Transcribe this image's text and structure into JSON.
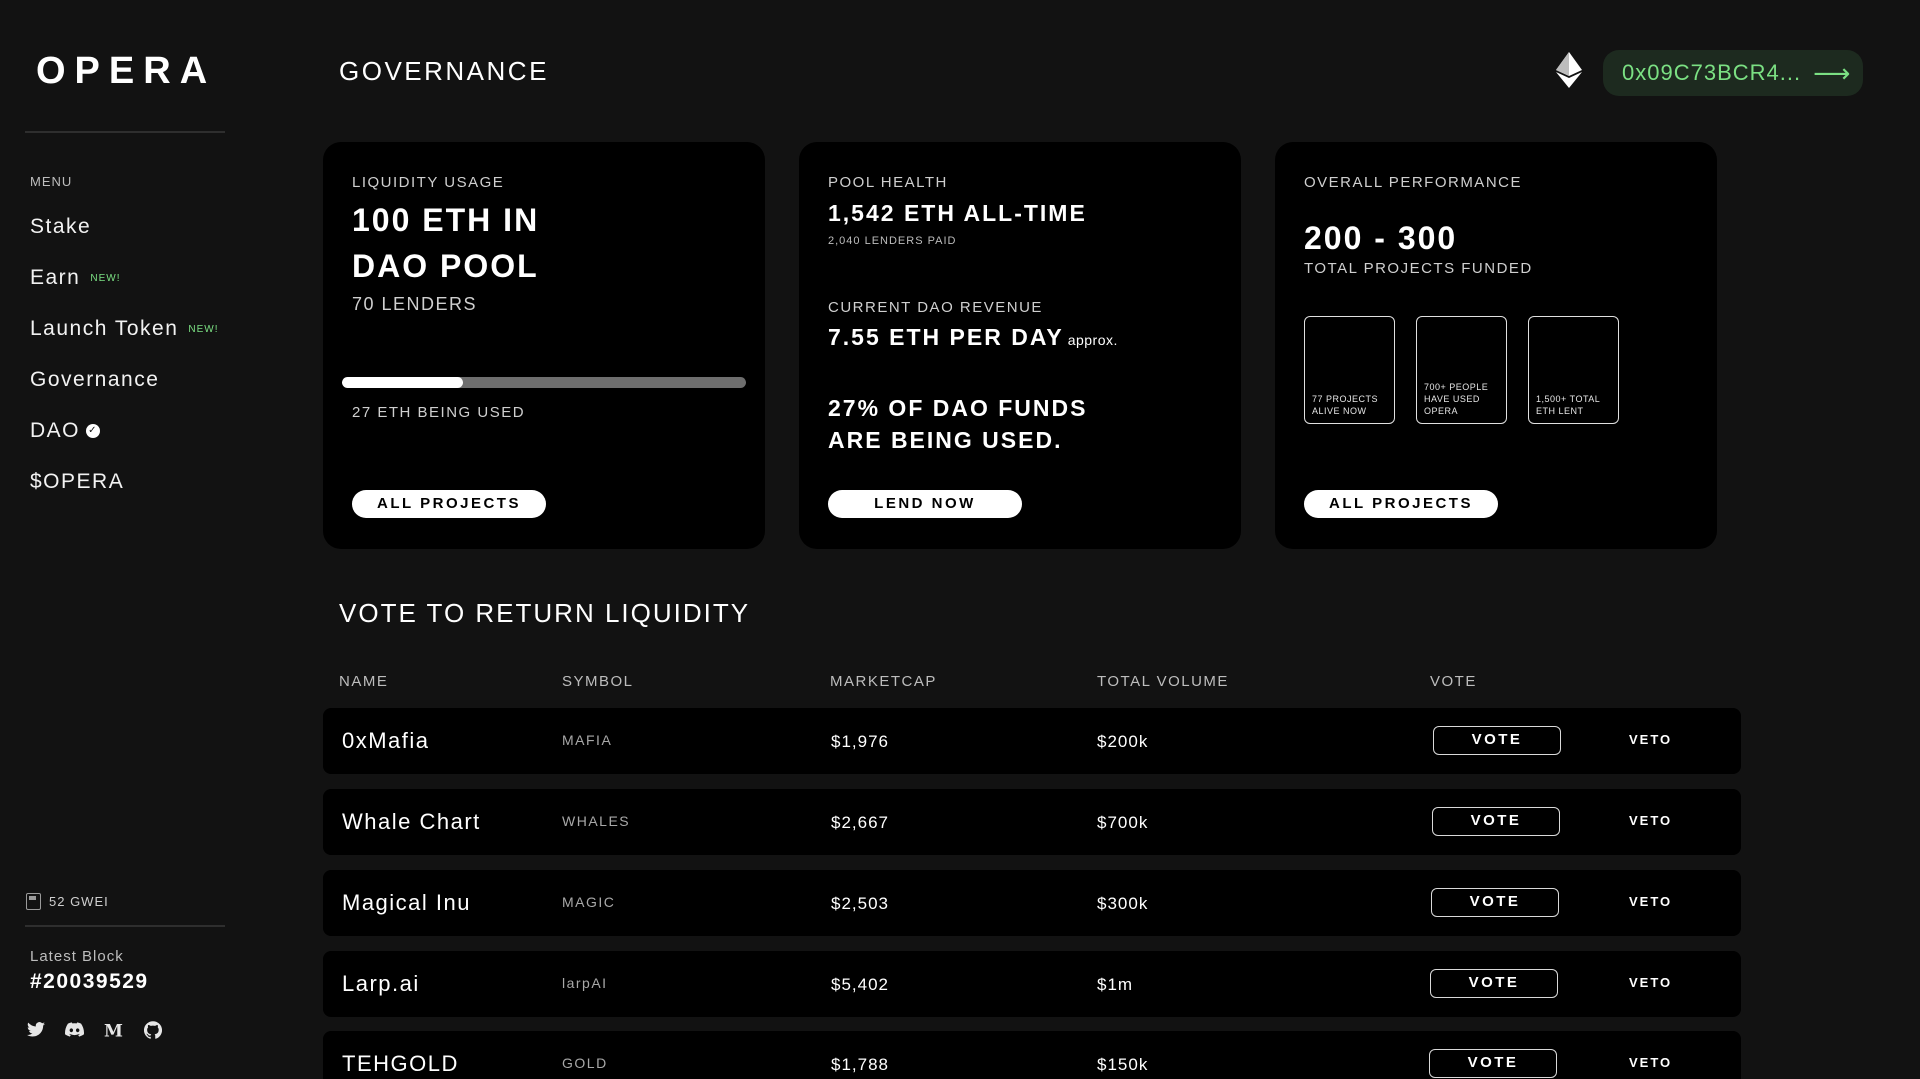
{
  "app": {
    "logo": "OPERA"
  },
  "sidebar": {
    "menu_title": "MENU",
    "items": [
      {
        "label": "Stake",
        "badge": ""
      },
      {
        "label": "Earn",
        "badge": "NEW!"
      },
      {
        "label": "Launch Token",
        "badge": "NEW!"
      },
      {
        "label": "Governance",
        "badge": ""
      },
      {
        "label": "DAO",
        "badge": ""
      },
      {
        "label": "$OPERA",
        "badge": ""
      }
    ],
    "gas": "52 GWEI",
    "latest_block_label": "Latest Block",
    "latest_block": "#20039529",
    "socials": [
      "twitter-icon",
      "discord-icon",
      "medium-icon",
      "github-icon"
    ]
  },
  "header": {
    "title": "GOVERNANCE",
    "wallet": "0x09C73BCR4...",
    "wallet_arrow": "⟶"
  },
  "cards": {
    "liquidity": {
      "label": "LIQUIDITY USAGE",
      "line1": "100 ETH IN",
      "line2": "DAO POOL",
      "lenders": "70 LENDERS",
      "progress": 0.3,
      "used": "27 ETH BEING USED",
      "button": "ALL PROJECTS"
    },
    "pool": {
      "label": "POOL HEALTH",
      "alltime": "1,542 ETH ALL-TIME",
      "lenders_paid": "2,040 LENDERS PAID",
      "revenue_label": "CURRENT DAO REVENUE",
      "revenue": "7.55 ETH PER DAY",
      "approx": "approx.",
      "funds_line1": "27% OF DAO FUNDS",
      "funds_line2": "ARE BEING USED.",
      "button": "LEND NOW"
    },
    "performance": {
      "label": "OVERALL PERFORMANCE",
      "range": "200 - 300",
      "funded": "TOTAL PROJECTS FUNDED",
      "stats": [
        "77 PROJECTS ALIVE NOW",
        "700+ PEOPLE HAVE USED OPERA",
        "1,500+ TOTAL ETH LENT"
      ],
      "button": "ALL PROJECTS"
    }
  },
  "vote_section": {
    "title": "VOTE TO RETURN LIQUIDITY",
    "columns": [
      "NAME",
      "SYMBOL",
      "MARKETCAP",
      "TOTAL VOLUME",
      "VOTE"
    ],
    "vote_label": "VOTE",
    "veto_label": "VETO",
    "rows": [
      {
        "name": "0xMafia",
        "symbol": "MAFIA",
        "marketcap": "$1,976",
        "volume": "$200k"
      },
      {
        "name": "Whale Chart",
        "symbol": "WHALES",
        "marketcap": "$2,667",
        "volume": "$700k"
      },
      {
        "name": "Magical Inu",
        "symbol": "MAGIC",
        "marketcap": "$2,503",
        "volume": "$300k"
      },
      {
        "name": "Larp.ai",
        "symbol": "larpAI",
        "marketcap": "$5,402",
        "volume": "$1m"
      },
      {
        "name": "TEHGOLD",
        "symbol": "GOLD",
        "marketcap": "$1,788",
        "volume": "$150k"
      }
    ]
  },
  "colors": {
    "background": "#121212",
    "card": "#000000",
    "accent_green": "#7be083",
    "wallet_bg": "#1d2a1f"
  }
}
